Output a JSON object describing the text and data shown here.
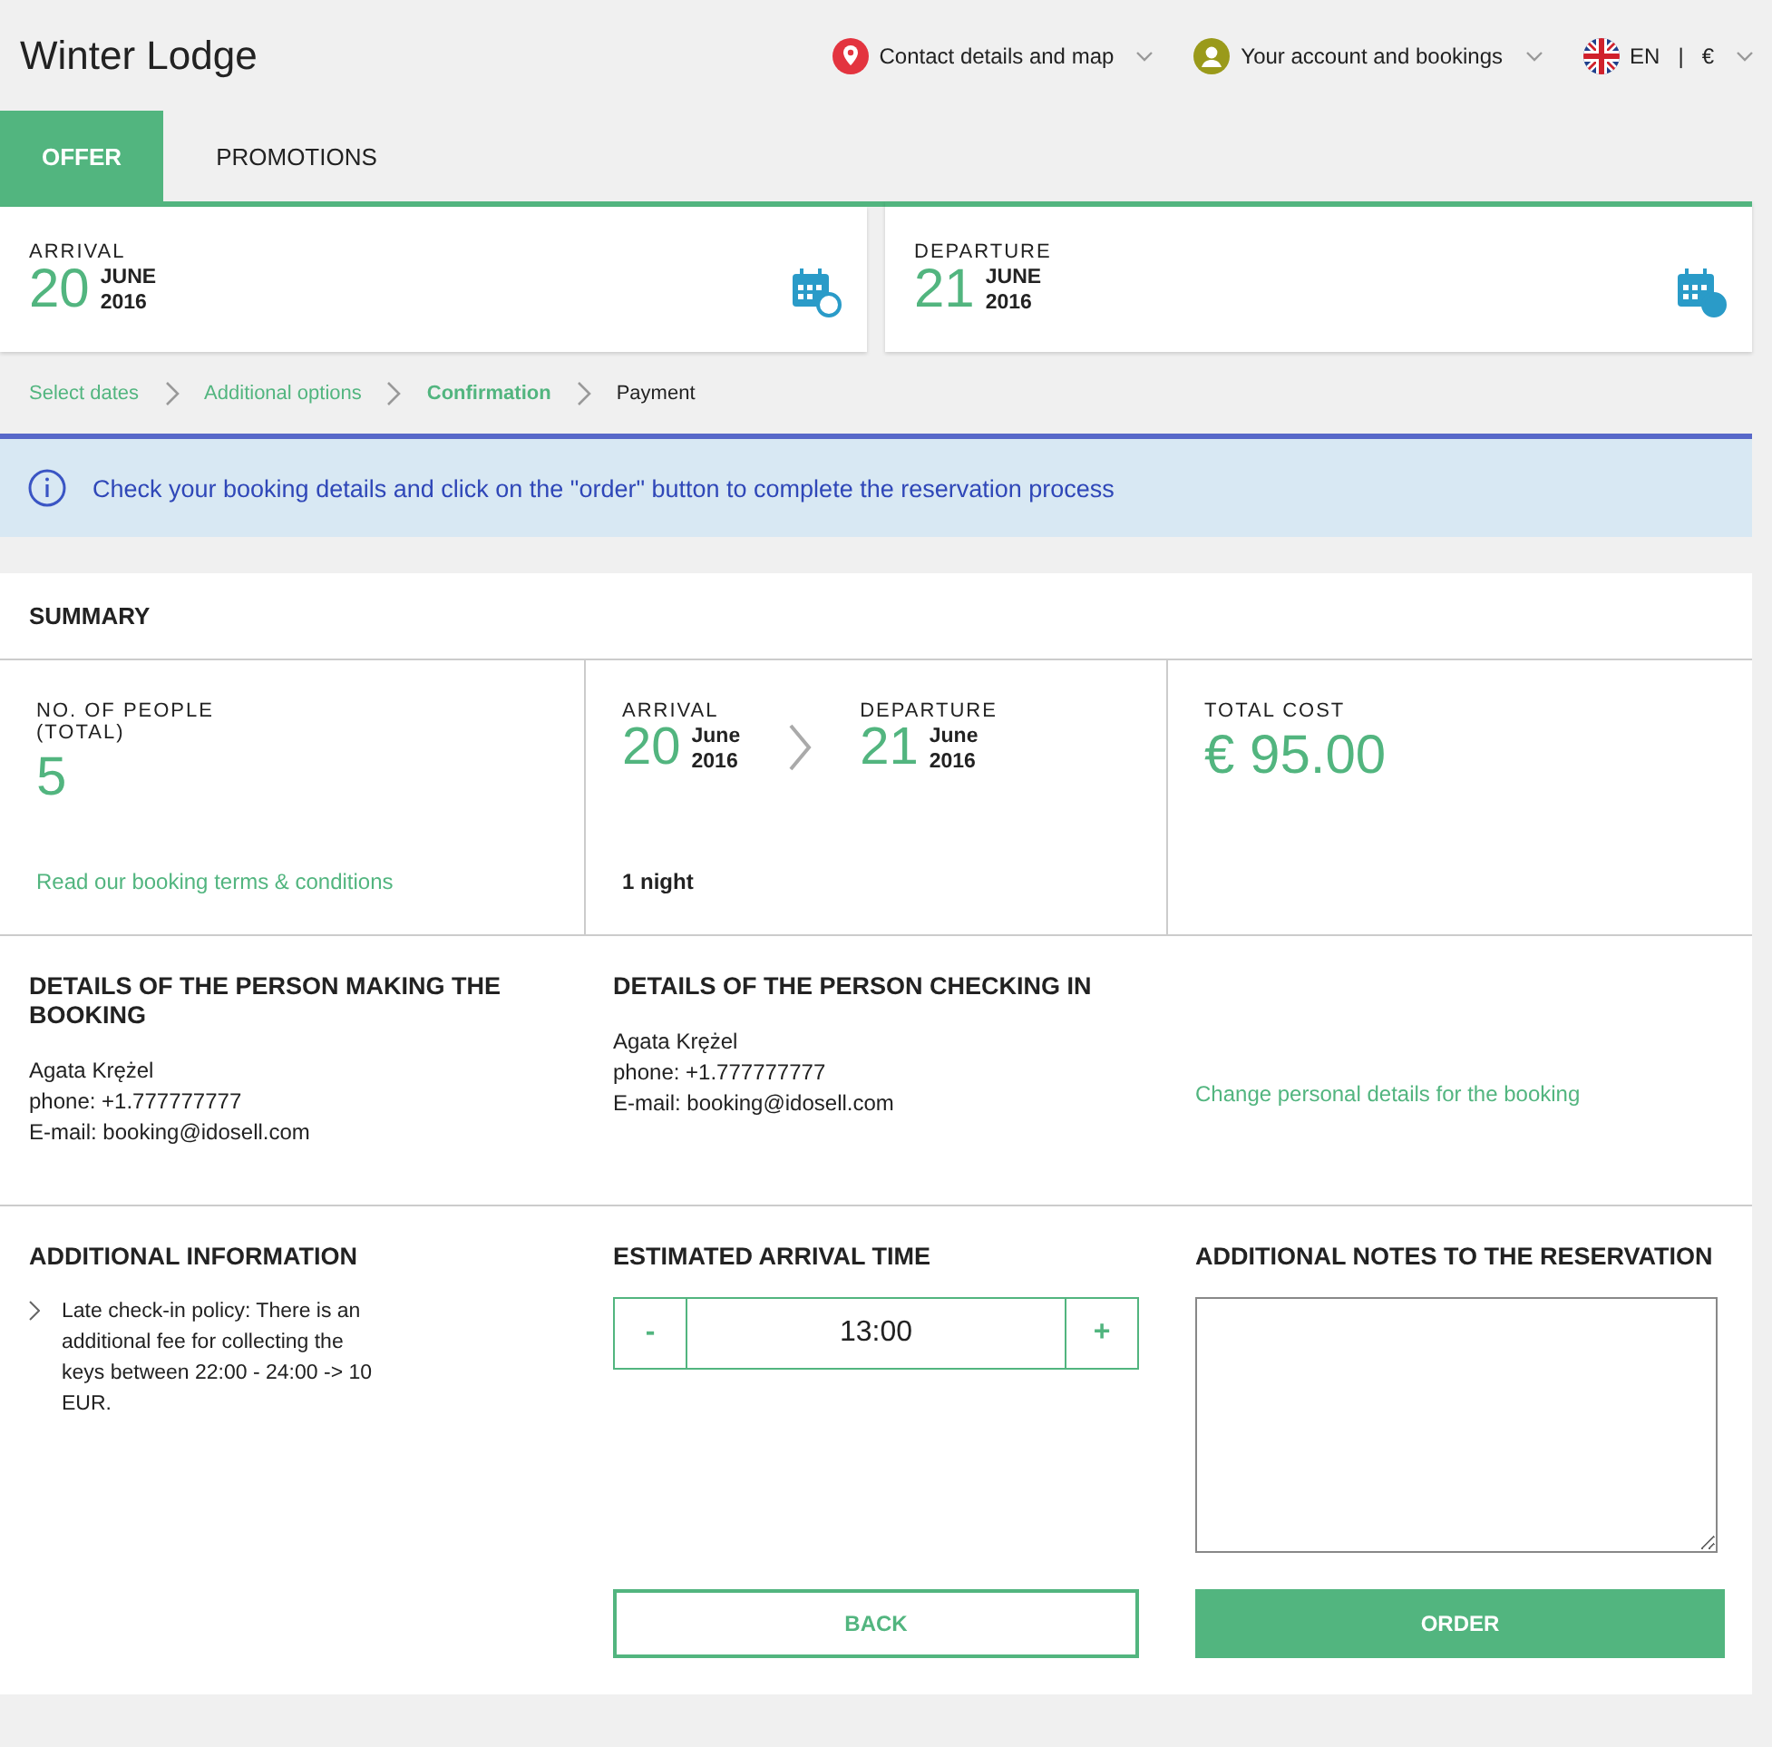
{
  "header": {
    "title": "Winter Lodge",
    "menus": [
      {
        "kind": "location",
        "label": "Contact details and map"
      },
      {
        "kind": "account",
        "label": "Your account and bookings"
      },
      {
        "kind": "locale",
        "label": "EN",
        "separator": "|",
        "currency": "€"
      }
    ]
  },
  "tabs": [
    {
      "label": "OFFER",
      "selected": true
    },
    {
      "label": "PROMOTIONS",
      "selected": false
    }
  ],
  "dates": [
    {
      "kind": "arrival",
      "label": "ARRIVAL",
      "day": "20",
      "month": "JUNE",
      "year": "2016"
    },
    {
      "kind": "departure",
      "label": "DEPARTURE",
      "day": "21",
      "month": "JUNE",
      "year": "2016"
    }
  ],
  "steps": [
    {
      "label": "Select dates",
      "done": true,
      "selected": false
    },
    {
      "label": "Additional options",
      "done": true,
      "selected": false
    },
    {
      "label": "Confirmation",
      "done": false,
      "selected": true
    },
    {
      "label": "Payment",
      "done": false,
      "selected": false
    }
  ],
  "notice": "Check your booking details and click on the \"order\" button to complete the reservation process",
  "summary": {
    "title": "SUMMARY",
    "people": {
      "label": "NO. OF PEOPLE",
      "sublabel": "(TOTAL)",
      "value": "5",
      "link": "Read our booking terms & conditions"
    },
    "stay": {
      "arrival": {
        "label": "ARRIVAL",
        "day": "20",
        "month": "June",
        "year": "2016"
      },
      "departure": {
        "label": "DEPARTURE",
        "day": "21",
        "month": "June",
        "year": "2016"
      },
      "nights": "1 night"
    },
    "cost": {
      "label": "TOTAL COST",
      "value": "€ 95.00"
    },
    "booker": {
      "title": "DETAILS OF THE PERSON MAKING THE BOOKING",
      "lines": [
        "Agata Krężel",
        "phone: +1.777777777",
        "E-mail: booking@idosell.com"
      ]
    },
    "guest": {
      "title": "DETAILS OF THE PERSON CHECKING IN",
      "lines": [
        "Agata Krężel",
        "phone: +1.777777777",
        "E-mail: booking@idosell.com"
      ]
    },
    "change_link": "Change personal details for the booking",
    "additional": {
      "title": "ADDITIONAL INFORMATION",
      "items": [
        "Late check-in policy: There is an additional fee for collecting the keys between 22:00 - 24:00 -> 10 EUR."
      ]
    },
    "arrival_time": {
      "title": "ESTIMATED ARRIVAL TIME",
      "minus": "-",
      "value": "13:00",
      "plus": "+"
    },
    "notes": {
      "title": "ADDITIONAL NOTES TO THE RESERVATION"
    },
    "buttons": [
      {
        "kind": "secondary",
        "label": "BACK"
      },
      {
        "kind": "primary",
        "label": "ORDER"
      }
    ]
  }
}
